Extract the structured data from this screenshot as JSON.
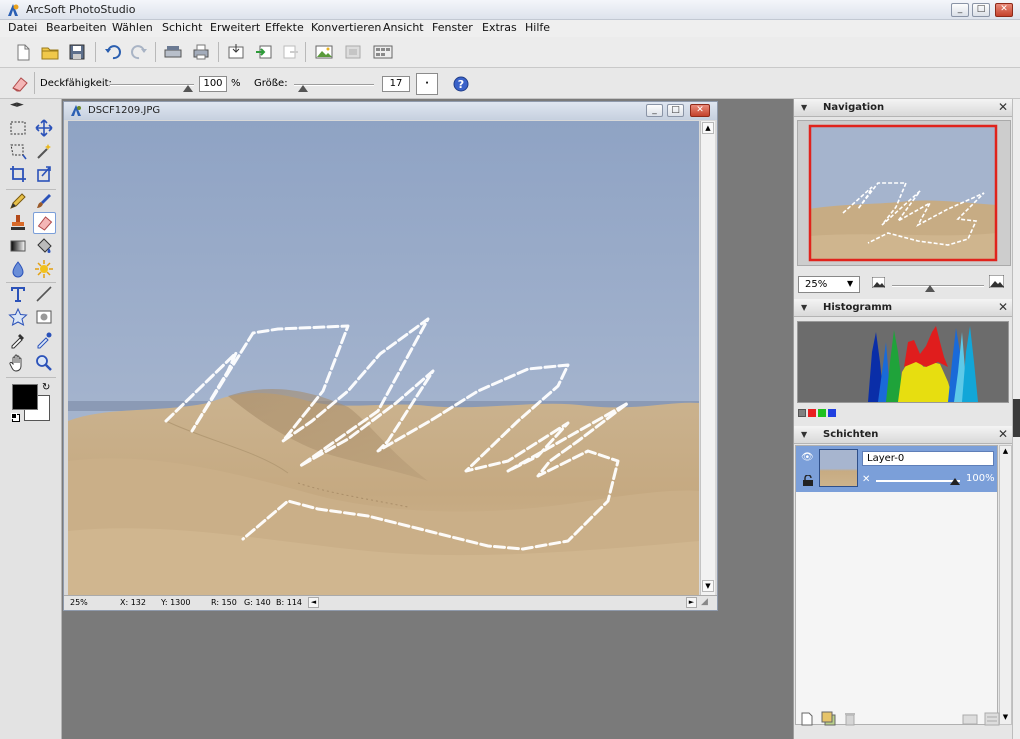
{
  "app": {
    "title": "ArcSoft PhotoStudio"
  },
  "menu": [
    "Datei",
    "Bearbeiten",
    "Wählen",
    "Schicht",
    "Erweitert",
    "Effekte",
    "Konvertieren",
    "Ansicht",
    "Fenster",
    "Extras",
    "Hilfe"
  ],
  "options": {
    "opacity_label": "Deckfähigkeit:",
    "opacity_value": "100",
    "opacity_unit": "%",
    "size_label": "Größe:",
    "size_value": "17",
    "brush_shape": "·"
  },
  "document": {
    "title": "DSCF1209.JPG",
    "status": {
      "zoom": "25%",
      "x": "X: 132",
      "y": "Y: 1300",
      "r": "R: 150",
      "g": "G: 140",
      "b": "B: 114"
    }
  },
  "navigation": {
    "title": "Navigation",
    "zoom": "25%",
    "view_frame_color": "#e0231c"
  },
  "histogram": {
    "title": "Histogramm",
    "channels": [
      "#808080",
      "#e82020",
      "#20c020",
      "#2040e0"
    ]
  },
  "layers": {
    "title": "Schichten",
    "items": [
      {
        "name": "Layer-0",
        "opacity": "100%"
      }
    ]
  },
  "colors": {
    "accent_blue": "#2f55d4",
    "selection": "#7b9fd9",
    "foreground": "#000000",
    "background": "#ffffff"
  }
}
